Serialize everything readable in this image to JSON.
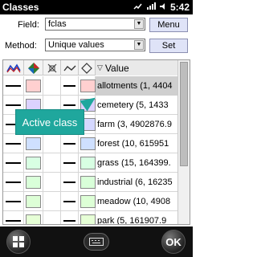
{
  "titlebar": {
    "title": "Classes",
    "time": "5:42"
  },
  "form": {
    "field_label": "Field:",
    "field_value": "fclas",
    "method_label": "Method:",
    "method_value": "Unique values",
    "menu_label": "Menu",
    "set_label": "Set"
  },
  "table": {
    "value_header": "Value",
    "rows": [
      {
        "color": "#ffd0d0",
        "value": "allotments (1, 4404"
      },
      {
        "color": "#dcd2ff",
        "value": "cemetery (5, 1433"
      },
      {
        "color": "#d5d8ff",
        "value": "farm (3, 4902876.9"
      },
      {
        "color": "#cfe0ff",
        "value": "forest (10, 615951"
      },
      {
        "color": "#d8ffe3",
        "value": "grass (15, 164399."
      },
      {
        "color": "#d9ffd9",
        "value": "industrial (6, 16235"
      },
      {
        "color": "#ddffd6",
        "value": "meadow (10, 4908"
      },
      {
        "color": "#e6ffd6",
        "value": "park (5, 161907.9"
      }
    ]
  },
  "tooltip": {
    "text": "Active class"
  },
  "bottombar": {
    "ok_label": "OK"
  }
}
